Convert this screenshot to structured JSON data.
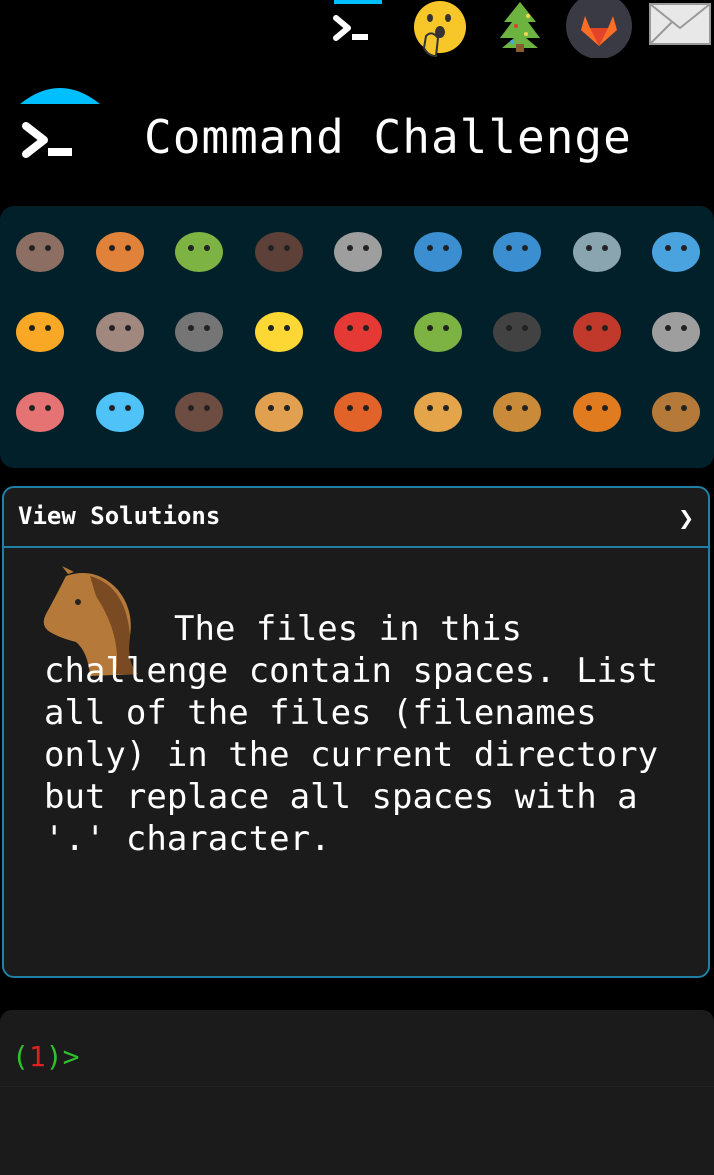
{
  "top_icons": [
    "terminal-icon",
    "shushing-face-icon",
    "christmas-tree-icon",
    "gitlab-icon",
    "envelope-icon"
  ],
  "header": {
    "title": "Command Challenge",
    "logo_icon": "terminal-icon"
  },
  "animals": [
    [
      "snail",
      "butterfly",
      "caterpillar",
      "ant",
      "spider-web",
      "whale",
      "dolphin",
      "shark",
      "fish"
    ],
    [
      "tropical-fish",
      "pufferfish",
      "wolf",
      "bee",
      "ladybug",
      "cricket",
      "spider",
      "scorpion",
      "fly"
    ],
    [
      "worm",
      "microbe",
      "monkey",
      "dog",
      "fox",
      "cat",
      "lion",
      "tiger",
      "horse"
    ]
  ],
  "panel": {
    "solutions_label": "View Solutions",
    "chevron": "❯",
    "challenge_icon": "horse-icon",
    "challenge_text": "The files in this challenge contain spaces. List all of the files (filenames only) in the current directory but replace all spaces with a '.' character."
  },
  "terminal": {
    "prompt_open": "(",
    "prompt_number": "1",
    "prompt_close": ")>"
  },
  "colors": {
    "accent": "#1f7fa6",
    "logo_cap": "#00bfff",
    "prompt_green": "#2ec12e",
    "prompt_red": "#e02020"
  }
}
